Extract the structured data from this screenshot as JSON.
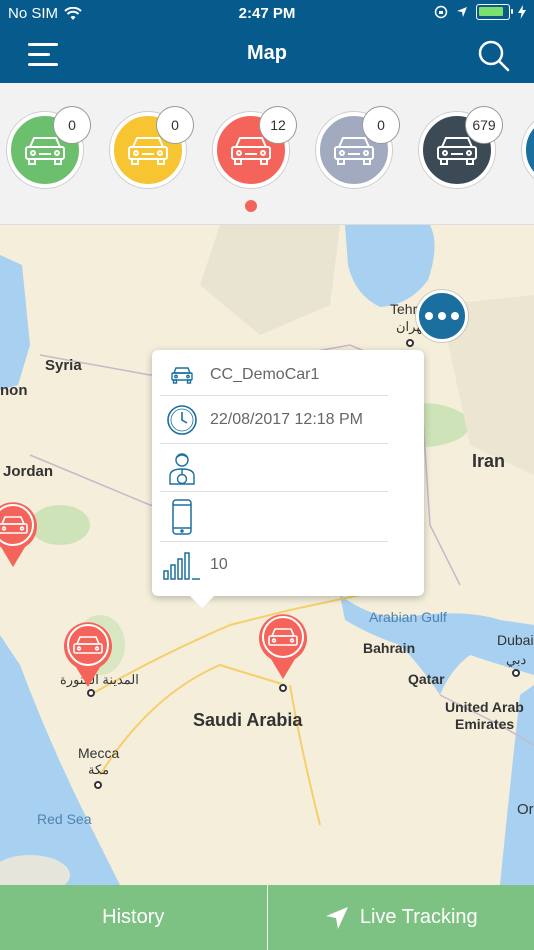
{
  "status": {
    "carrier": "No SIM",
    "time": "2:47 PM"
  },
  "header": {
    "title": "Map"
  },
  "filters": [
    {
      "color": "#6cbf6c",
      "count": "0"
    },
    {
      "color": "#f7c531",
      "count": "0"
    },
    {
      "color": "#f5645a",
      "count": "12"
    },
    {
      "color": "#a2aac0",
      "count": "0"
    },
    {
      "color": "#3c4a55",
      "count": "679"
    },
    {
      "color": "#1b6f9e",
      "count": ""
    }
  ],
  "map": {
    "labels": {
      "tehran": "Tehr",
      "tehran_ar": "تهران",
      "syria": "Syria",
      "lebanon": "non",
      "jordan": "Jordan",
      "iran": "Iran",
      "arabian_gulf": "Arabian Gulf",
      "bahrain": "Bahrain",
      "qatar": "Qatar",
      "dubai": "Dubai",
      "dubai_ar": "دبي",
      "uae_1": "United Arab",
      "uae_2": "Emirates",
      "saudi": "Saudi Arabia",
      "medina_ar": "المدينة المنورة",
      "mecca": "Mecca",
      "mecca_ar": "مكة",
      "red_sea": "Red Sea",
      "oman_partial": "Or"
    }
  },
  "popup": {
    "car_name": "CC_DemoCar1",
    "datetime": "22/08/2017 12:18 PM",
    "driver": "",
    "phone": "",
    "signal": "10"
  },
  "bottom": {
    "history": "History",
    "live_tracking": "Live Tracking"
  },
  "colors": {
    "header": "#075a8c",
    "bottom": "#7dc283",
    "pin": "#f5645a"
  }
}
